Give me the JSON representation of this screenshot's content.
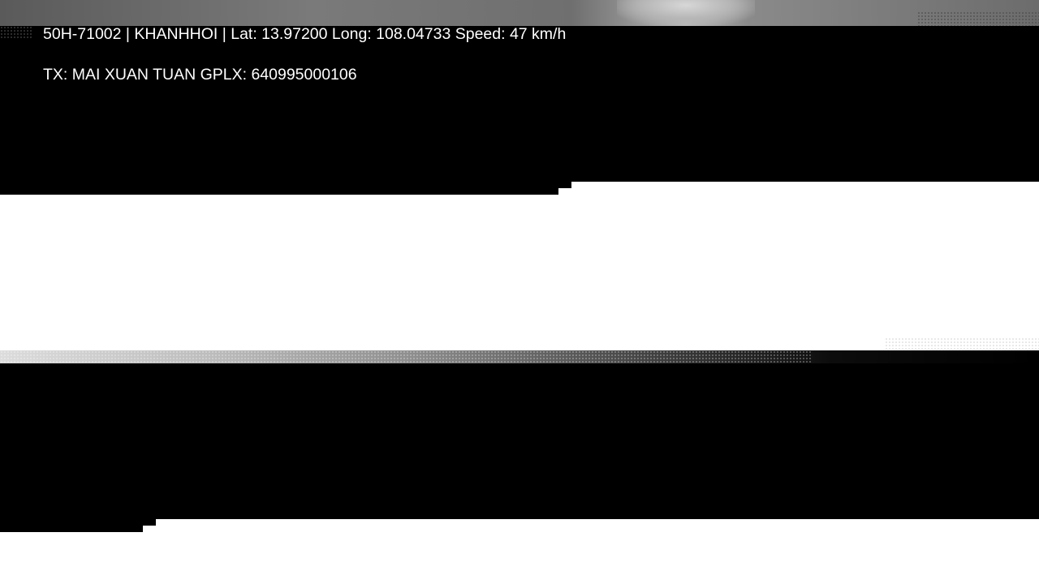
{
  "overlay": {
    "line1": "50H-71002 | KHANHHOI | Lat: 13.97200 Long: 108.04733 Speed: 47 km/h",
    "line2": "TX: MAI XUAN TUAN GPLX: 640995000106"
  },
  "colors": {
    "overlay_text": "#ffffff",
    "background": "#000000",
    "white_band": "#ffffff"
  }
}
